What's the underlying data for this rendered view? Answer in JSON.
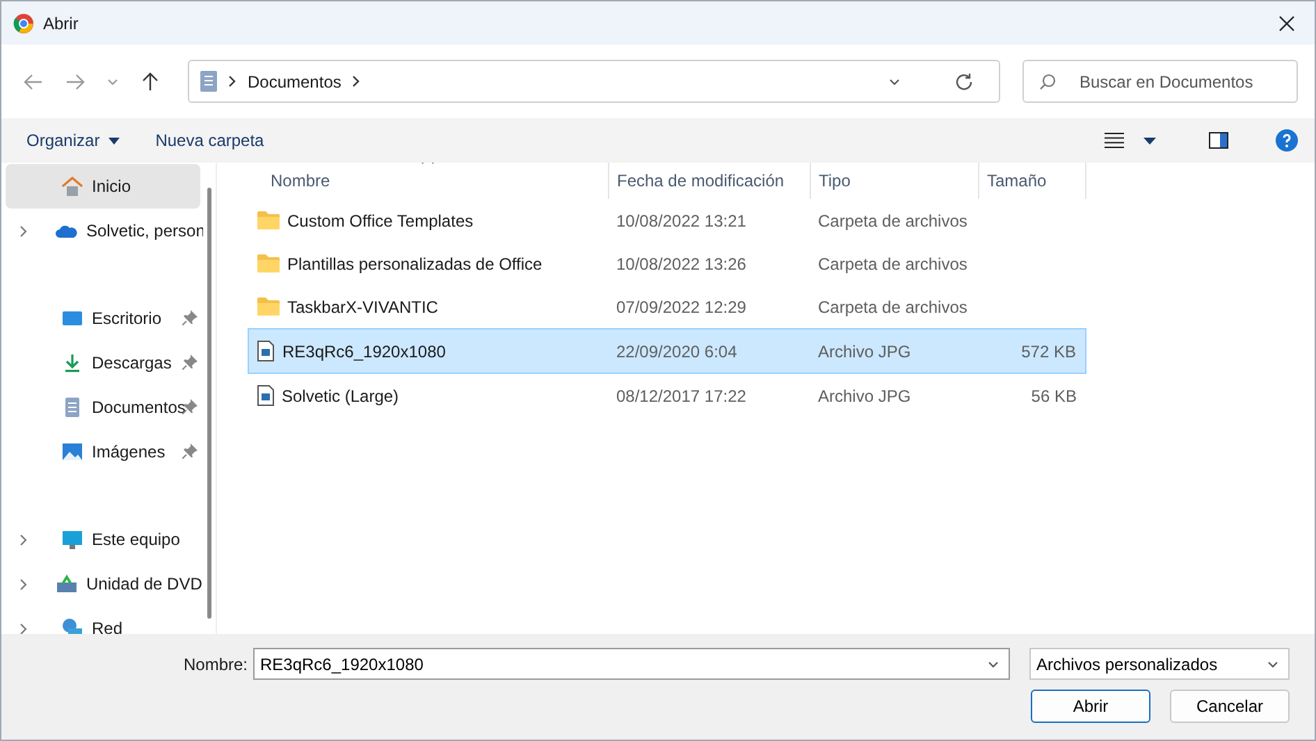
{
  "window": {
    "title": "Abrir"
  },
  "address": {
    "path": [
      "Documentos"
    ]
  },
  "search": {
    "placeholder": "Buscar en Documentos"
  },
  "toolbar": {
    "organize": "Organizar",
    "new_folder": "Nueva carpeta"
  },
  "sidebar": {
    "groups": [
      [
        {
          "label": "Inicio",
          "kind": "home",
          "expandable": false,
          "pinned": false,
          "selected": true
        },
        {
          "label": "Solvetic, person",
          "kind": "cloud",
          "expandable": true,
          "pinned": false,
          "selected": false
        }
      ],
      [
        {
          "label": "Escritorio",
          "kind": "desktop",
          "expandable": false,
          "pinned": true,
          "selected": false
        },
        {
          "label": "Descargas",
          "kind": "downloads",
          "expandable": false,
          "pinned": true,
          "selected": false
        },
        {
          "label": "Documentos",
          "kind": "documents",
          "expandable": false,
          "pinned": true,
          "selected": false
        },
        {
          "label": "Imágenes",
          "kind": "pictures",
          "expandable": false,
          "pinned": true,
          "selected": false
        }
      ],
      [
        {
          "label": "Este equipo",
          "kind": "pc",
          "expandable": true,
          "pinned": false,
          "selected": false
        },
        {
          "label": "Unidad de DVD",
          "kind": "dvd",
          "expandable": true,
          "pinned": false,
          "selected": false
        },
        {
          "label": "Red",
          "kind": "network",
          "expandable": true,
          "pinned": false,
          "selected": false
        }
      ]
    ]
  },
  "table": {
    "columns": [
      "Nombre",
      "Fecha de modificación",
      "Tipo",
      "Tamaño"
    ],
    "rows": [
      {
        "kind": "folder",
        "name": "Custom Office Templates",
        "date": "10/08/2022 13:21",
        "type": "Carpeta de archivos",
        "size": "",
        "selected": false
      },
      {
        "kind": "folder",
        "name": "Plantillas personalizadas de Office",
        "date": "10/08/2022 13:26",
        "type": "Carpeta de archivos",
        "size": "",
        "selected": false
      },
      {
        "kind": "folder",
        "name": "TaskbarX-VIVANTIC",
        "date": "07/09/2022 12:29",
        "type": "Carpeta de archivos",
        "size": "",
        "selected": false
      },
      {
        "kind": "image",
        "name": "RE3qRc6_1920x1080",
        "date": "22/09/2020 6:04",
        "type": "Archivo JPG",
        "size": "572 KB",
        "selected": true
      },
      {
        "kind": "image",
        "name": "Solvetic (Large)",
        "date": "08/12/2017 17:22",
        "type": "Archivo JPG",
        "size": "56 KB",
        "selected": false
      }
    ]
  },
  "footer": {
    "name_label": "Nombre:",
    "name_value": "RE3qRc6_1920x1080",
    "filter": "Archivos personalizados",
    "buttons": [
      {
        "label": "Abrir",
        "kind": "primary"
      },
      {
        "label": "Cancelar",
        "kind": "secondary"
      }
    ]
  }
}
